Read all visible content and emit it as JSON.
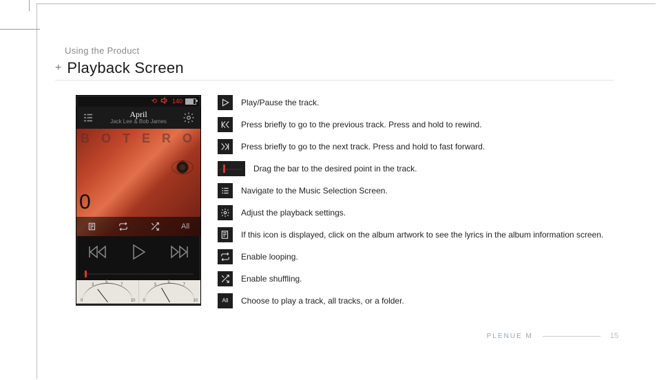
{
  "section_label": "Using the Product",
  "title_plus": "+",
  "title": "Playback Screen",
  "device": {
    "status": {
      "volume": "140",
      "loop_glyph": "⟲",
      "vol_glyph": "🔊"
    },
    "track": {
      "title": "April",
      "artist": "Jack Lee & Bob James"
    },
    "artwork": {
      "letters": "B O T E R O",
      "zero": "0"
    },
    "overlay": {
      "mode_all": "All"
    },
    "vu": {
      "ticks_left": [
        "0",
        "3",
        "5",
        "7",
        "10"
      ],
      "ticks_right": [
        "0",
        "3",
        "5",
        "7",
        "10"
      ]
    }
  },
  "legend": {
    "play": "Play/Pause the track.",
    "prev": "Press briefly to go to the previous track. Press and hold to rewind.",
    "next": "Press briefly to go to the next track. Press and hold to fast forward.",
    "seek": "Drag the bar to the desired point in the track.",
    "library": "Navigate to the Music Selection Screen.",
    "settings": "Adjust the playback settings.",
    "lyrics": "If this icon is displayed, click on the album artwork to see the lyrics in the album information screen.",
    "loop": "Enable looping.",
    "shuffle": "Enable shuffling.",
    "playmode": "Choose to play a track, all tracks, or a folder.",
    "playmode_chip": "All"
  },
  "footer": {
    "product": "PLENUE M",
    "page": "15"
  }
}
